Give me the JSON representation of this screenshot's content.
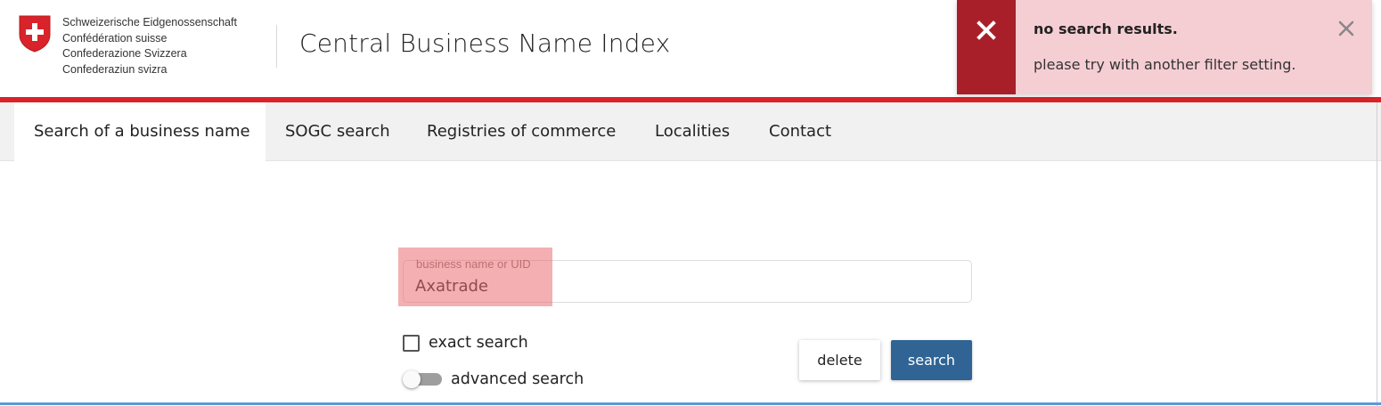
{
  "header": {
    "confederation_lines": [
      "Schweizerische Eidgenossenschaft",
      "Confédération suisse",
      "Confederazione Svizzera",
      "Confederaziun svizra"
    ],
    "app_title": "Central Business Name Index",
    "crest_icon": "swiss-crest-icon"
  },
  "nav": {
    "items": [
      {
        "label": "Search of a business name",
        "active": true
      },
      {
        "label": "SOGC search",
        "active": false
      },
      {
        "label": "Registries of commerce",
        "active": false
      },
      {
        "label": "Localities",
        "active": false
      },
      {
        "label": "Contact",
        "active": false
      }
    ]
  },
  "toast": {
    "title": "no search results.",
    "message": "please try with another filter setting.",
    "icon": "error-x-icon",
    "close_icon": "close-icon"
  },
  "search": {
    "label": "business name or UID",
    "value": "Axatrade"
  },
  "options": {
    "exact_label": "exact search",
    "exact_checked": false,
    "advanced_label": "advanced search",
    "advanced_on": false
  },
  "buttons": {
    "delete_label": "delete",
    "search_label": "search"
  },
  "colors": {
    "brand_red": "#d8232a",
    "toast_bg": "#f5ced4",
    "toast_icon_bg": "#a81f29",
    "primary_blue": "#2f6495"
  }
}
